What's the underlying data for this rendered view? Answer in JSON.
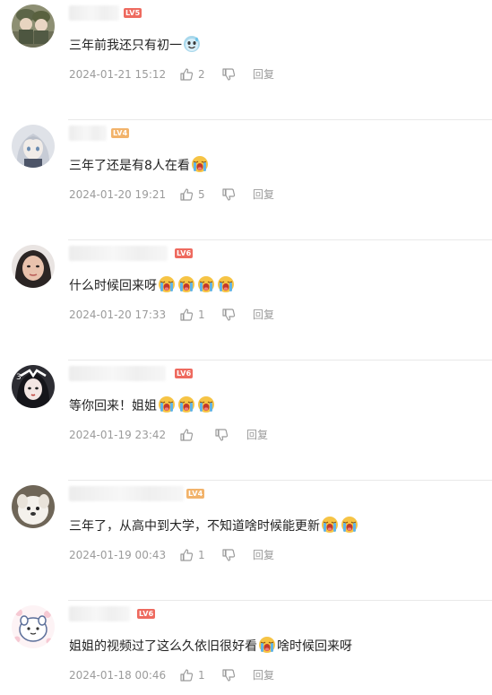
{
  "comments": [
    {
      "level": "LV5",
      "text": "三年前我还只有初一",
      "emojis": [
        "sweat-smile-emoji"
      ],
      "date": "2024-01-21 15:12",
      "likes": "2",
      "reply_label": "回复"
    },
    {
      "level": "LV4",
      "text": "三年了还是有8人在看",
      "emojis": [
        "crying-emoji"
      ],
      "date": "2024-01-20 19:21",
      "likes": "5",
      "reply_label": "回复"
    },
    {
      "level": "LV6",
      "text": "什么时候回来呀",
      "emojis": [
        "crying-emoji",
        "crying-emoji",
        "crying-emoji",
        "crying-emoji"
      ],
      "date": "2024-01-20 17:33",
      "likes": "1",
      "reply_label": "回复"
    },
    {
      "level": "LV6",
      "text": "等你回来！姐姐",
      "emojis": [
        "crying-emoji",
        "crying-emoji",
        "crying-emoji"
      ],
      "date": "2024-01-19 23:42",
      "likes": "",
      "reply_label": "回复"
    },
    {
      "level": "LV4",
      "text": "三年了，从高中到大学，不知道啥时候能更新",
      "emojis": [
        "crying-emoji",
        "crying-emoji"
      ],
      "date": "2024-01-19 00:43",
      "likes": "1",
      "reply_label": "回复"
    },
    {
      "level": "LV6",
      "text": "姐姐的视频过了这么久依旧很好看",
      "text_after_emoji": "啥时候回来呀",
      "emojis": [
        "crying-emoji"
      ],
      "date": "2024-01-18 00:46",
      "likes": "1",
      "reply_label": "回复"
    }
  ],
  "colors": {
    "level_red": "#ee6a5f",
    "level_orange": "#f2b36b",
    "meta_gray": "#9b9b9b",
    "text": "#222222"
  }
}
